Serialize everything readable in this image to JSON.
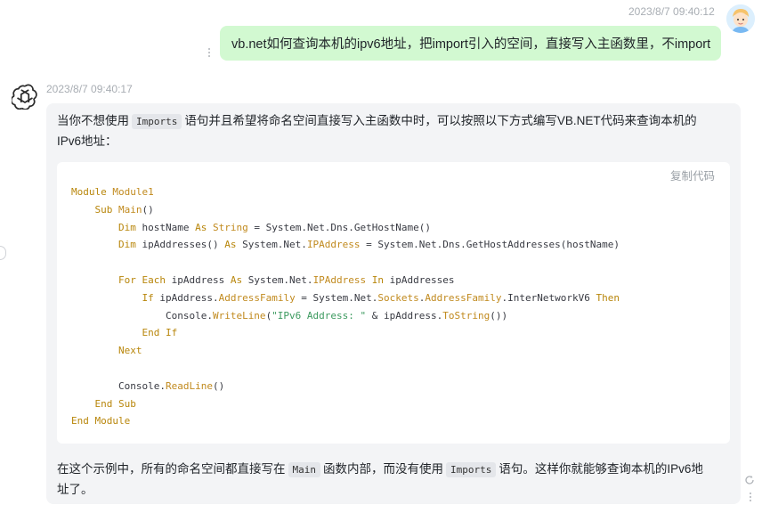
{
  "user_message": {
    "timestamp": "2023/8/7 09:40:12",
    "text": "vb.net如何查询本机的ipv6地址，把import引入的空间，直接写入主函数里，不import"
  },
  "assistant_message": {
    "timestamp": "2023/8/7 09:40:17",
    "intro": {
      "before": "当你不想使用",
      "code": "Imports",
      "after_line1": "语句并且希望将命名空间直接写入主函数中时，可以按照以下方式编写VB.NET代码来查询本机的",
      "after_line2": "IPv6地址："
    },
    "copy_label": "复制代码",
    "code_lines": [
      [
        {
          "t": "kw",
          "v": "Module"
        },
        {
          "t": "p",
          "v": " "
        },
        {
          "t": "ty",
          "v": "Module1"
        }
      ],
      [
        {
          "t": "p",
          "v": "    "
        },
        {
          "t": "kw",
          "v": "Sub"
        },
        {
          "t": "p",
          "v": " "
        },
        {
          "t": "ty",
          "v": "Main"
        },
        {
          "t": "p",
          "v": "()"
        }
      ],
      [
        {
          "t": "p",
          "v": "        "
        },
        {
          "t": "kw",
          "v": "Dim"
        },
        {
          "t": "p",
          "v": " hostName "
        },
        {
          "t": "kw",
          "v": "As"
        },
        {
          "t": "p",
          "v": " "
        },
        {
          "t": "ty",
          "v": "String"
        },
        {
          "t": "p",
          "v": " = System.Net.Dns.GetHostName()"
        }
      ],
      [
        {
          "t": "p",
          "v": "        "
        },
        {
          "t": "kw",
          "v": "Dim"
        },
        {
          "t": "p",
          "v": " ipAddresses() "
        },
        {
          "t": "kw",
          "v": "As"
        },
        {
          "t": "p",
          "v": " System.Net."
        },
        {
          "t": "ty",
          "v": "IPAddress"
        },
        {
          "t": "p",
          "v": " = System.Net.Dns.GetHostAddresses(hostName)"
        }
      ],
      [],
      [
        {
          "t": "p",
          "v": "        "
        },
        {
          "t": "kw",
          "v": "For Each"
        },
        {
          "t": "p",
          "v": " ipAddress "
        },
        {
          "t": "kw",
          "v": "As"
        },
        {
          "t": "p",
          "v": " System.Net."
        },
        {
          "t": "ty",
          "v": "IPAddress"
        },
        {
          "t": "p",
          "v": " "
        },
        {
          "t": "kw",
          "v": "In"
        },
        {
          "t": "p",
          "v": " ipAddresses"
        }
      ],
      [
        {
          "t": "p",
          "v": "            "
        },
        {
          "t": "kw",
          "v": "If"
        },
        {
          "t": "p",
          "v": " ipAddress."
        },
        {
          "t": "ty",
          "v": "AddressFamily"
        },
        {
          "t": "p",
          "v": " = System.Net."
        },
        {
          "t": "ty",
          "v": "Sockets"
        },
        {
          "t": "p",
          "v": "."
        },
        {
          "t": "ty",
          "v": "AddressFamily"
        },
        {
          "t": "p",
          "v": ".InterNetworkV6 "
        },
        {
          "t": "kw",
          "v": "Then"
        }
      ],
      [
        {
          "t": "p",
          "v": "                Console."
        },
        {
          "t": "fn",
          "v": "WriteLine"
        },
        {
          "t": "p",
          "v": "("
        },
        {
          "t": "str",
          "v": "\"IPv6 Address: \""
        },
        {
          "t": "p",
          "v": " & ipAddress."
        },
        {
          "t": "fn",
          "v": "ToString"
        },
        {
          "t": "p",
          "v": "())"
        }
      ],
      [
        {
          "t": "p",
          "v": "            "
        },
        {
          "t": "kw",
          "v": "End If"
        }
      ],
      [
        {
          "t": "p",
          "v": "        "
        },
        {
          "t": "kw",
          "v": "Next"
        }
      ],
      [],
      [
        {
          "t": "p",
          "v": "        Console."
        },
        {
          "t": "fn",
          "v": "ReadLine"
        },
        {
          "t": "p",
          "v": "()"
        }
      ],
      [
        {
          "t": "p",
          "v": "    "
        },
        {
          "t": "kw",
          "v": "End Sub"
        }
      ],
      [
        {
          "t": "kw",
          "v": "End Module"
        }
      ]
    ],
    "outro": {
      "before": "在这个示例中，所有的命名空间都直接写在",
      "code1": "Main",
      "middle": "函数内部，而没有使用",
      "code2": "Imports",
      "after_line1": "语句。这样你就能够查询本机的IPv6地",
      "after_line2": "址了。"
    }
  },
  "icons": {
    "user_avatar": "user-avatar",
    "assistant_logo": "openai-logo-icon",
    "more_menu": "kebab-icon",
    "refresh": "refresh-icon"
  }
}
